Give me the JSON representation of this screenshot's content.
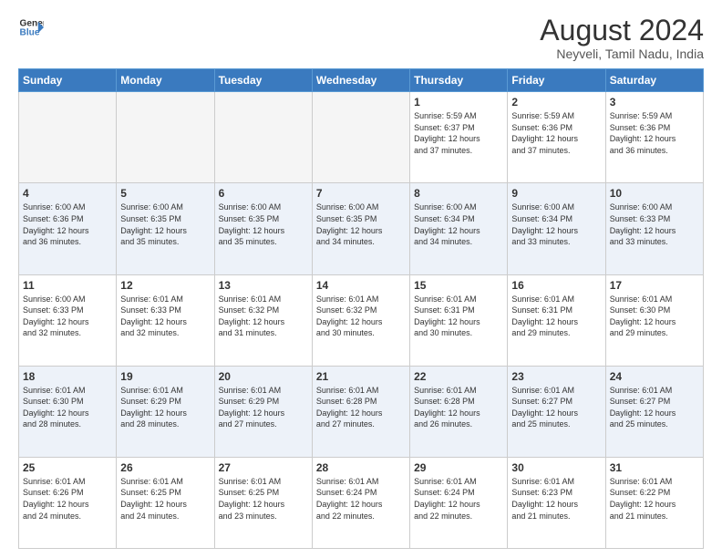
{
  "header": {
    "logo_line1": "General",
    "logo_line2": "Blue",
    "month": "August 2024",
    "location": "Neyveli, Tamil Nadu, India"
  },
  "days_of_week": [
    "Sunday",
    "Monday",
    "Tuesday",
    "Wednesday",
    "Thursday",
    "Friday",
    "Saturday"
  ],
  "weeks": [
    [
      {
        "day": "",
        "info": ""
      },
      {
        "day": "",
        "info": ""
      },
      {
        "day": "",
        "info": ""
      },
      {
        "day": "",
        "info": ""
      },
      {
        "day": "1",
        "info": "Sunrise: 5:59 AM\nSunset: 6:37 PM\nDaylight: 12 hours\nand 37 minutes."
      },
      {
        "day": "2",
        "info": "Sunrise: 5:59 AM\nSunset: 6:36 PM\nDaylight: 12 hours\nand 37 minutes."
      },
      {
        "day": "3",
        "info": "Sunrise: 5:59 AM\nSunset: 6:36 PM\nDaylight: 12 hours\nand 36 minutes."
      }
    ],
    [
      {
        "day": "4",
        "info": "Sunrise: 6:00 AM\nSunset: 6:36 PM\nDaylight: 12 hours\nand 36 minutes."
      },
      {
        "day": "5",
        "info": "Sunrise: 6:00 AM\nSunset: 6:35 PM\nDaylight: 12 hours\nand 35 minutes."
      },
      {
        "day": "6",
        "info": "Sunrise: 6:00 AM\nSunset: 6:35 PM\nDaylight: 12 hours\nand 35 minutes."
      },
      {
        "day": "7",
        "info": "Sunrise: 6:00 AM\nSunset: 6:35 PM\nDaylight: 12 hours\nand 34 minutes."
      },
      {
        "day": "8",
        "info": "Sunrise: 6:00 AM\nSunset: 6:34 PM\nDaylight: 12 hours\nand 34 minutes."
      },
      {
        "day": "9",
        "info": "Sunrise: 6:00 AM\nSunset: 6:34 PM\nDaylight: 12 hours\nand 33 minutes."
      },
      {
        "day": "10",
        "info": "Sunrise: 6:00 AM\nSunset: 6:33 PM\nDaylight: 12 hours\nand 33 minutes."
      }
    ],
    [
      {
        "day": "11",
        "info": "Sunrise: 6:00 AM\nSunset: 6:33 PM\nDaylight: 12 hours\nand 32 minutes."
      },
      {
        "day": "12",
        "info": "Sunrise: 6:01 AM\nSunset: 6:33 PM\nDaylight: 12 hours\nand 32 minutes."
      },
      {
        "day": "13",
        "info": "Sunrise: 6:01 AM\nSunset: 6:32 PM\nDaylight: 12 hours\nand 31 minutes."
      },
      {
        "day": "14",
        "info": "Sunrise: 6:01 AM\nSunset: 6:32 PM\nDaylight: 12 hours\nand 30 minutes."
      },
      {
        "day": "15",
        "info": "Sunrise: 6:01 AM\nSunset: 6:31 PM\nDaylight: 12 hours\nand 30 minutes."
      },
      {
        "day": "16",
        "info": "Sunrise: 6:01 AM\nSunset: 6:31 PM\nDaylight: 12 hours\nand 29 minutes."
      },
      {
        "day": "17",
        "info": "Sunrise: 6:01 AM\nSunset: 6:30 PM\nDaylight: 12 hours\nand 29 minutes."
      }
    ],
    [
      {
        "day": "18",
        "info": "Sunrise: 6:01 AM\nSunset: 6:30 PM\nDaylight: 12 hours\nand 28 minutes."
      },
      {
        "day": "19",
        "info": "Sunrise: 6:01 AM\nSunset: 6:29 PM\nDaylight: 12 hours\nand 28 minutes."
      },
      {
        "day": "20",
        "info": "Sunrise: 6:01 AM\nSunset: 6:29 PM\nDaylight: 12 hours\nand 27 minutes."
      },
      {
        "day": "21",
        "info": "Sunrise: 6:01 AM\nSunset: 6:28 PM\nDaylight: 12 hours\nand 27 minutes."
      },
      {
        "day": "22",
        "info": "Sunrise: 6:01 AM\nSunset: 6:28 PM\nDaylight: 12 hours\nand 26 minutes."
      },
      {
        "day": "23",
        "info": "Sunrise: 6:01 AM\nSunset: 6:27 PM\nDaylight: 12 hours\nand 25 minutes."
      },
      {
        "day": "24",
        "info": "Sunrise: 6:01 AM\nSunset: 6:27 PM\nDaylight: 12 hours\nand 25 minutes."
      }
    ],
    [
      {
        "day": "25",
        "info": "Sunrise: 6:01 AM\nSunset: 6:26 PM\nDaylight: 12 hours\nand 24 minutes."
      },
      {
        "day": "26",
        "info": "Sunrise: 6:01 AM\nSunset: 6:25 PM\nDaylight: 12 hours\nand 24 minutes."
      },
      {
        "day": "27",
        "info": "Sunrise: 6:01 AM\nSunset: 6:25 PM\nDaylight: 12 hours\nand 23 minutes."
      },
      {
        "day": "28",
        "info": "Sunrise: 6:01 AM\nSunset: 6:24 PM\nDaylight: 12 hours\nand 22 minutes."
      },
      {
        "day": "29",
        "info": "Sunrise: 6:01 AM\nSunset: 6:24 PM\nDaylight: 12 hours\nand 22 minutes."
      },
      {
        "day": "30",
        "info": "Sunrise: 6:01 AM\nSunset: 6:23 PM\nDaylight: 12 hours\nand 21 minutes."
      },
      {
        "day": "31",
        "info": "Sunrise: 6:01 AM\nSunset: 6:22 PM\nDaylight: 12 hours\nand 21 minutes."
      }
    ]
  ]
}
